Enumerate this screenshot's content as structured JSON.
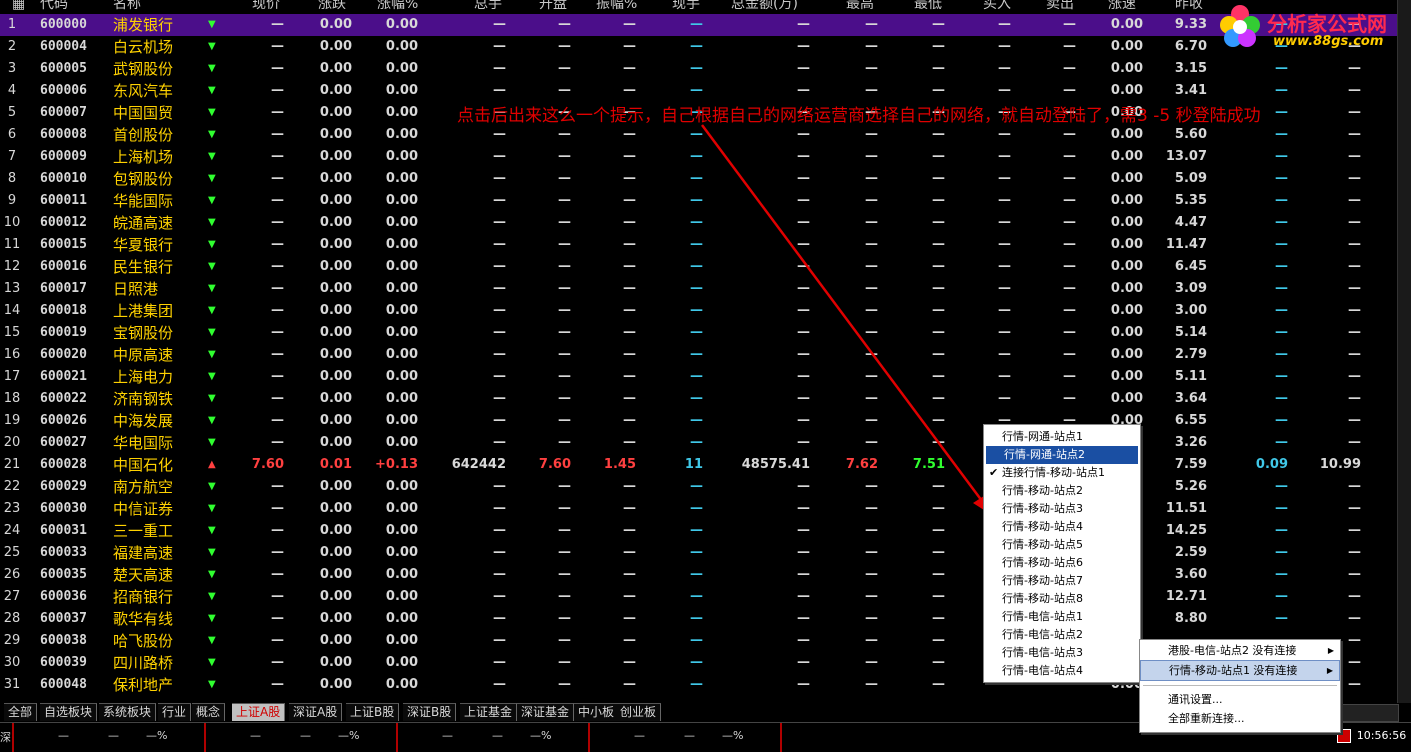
{
  "header": {
    "code": "代码",
    "name": "名称",
    "price": "现价",
    "change": "涨跌",
    "pct": "涨幅%",
    "volume": "总手",
    "open": "开盘",
    "amplitude": "振幅%",
    "cur_vol": "现手",
    "amount": "总金额(万)",
    "high": "最高",
    "low": "最低",
    "buy": "买入",
    "sell": "卖出",
    "speed": "涨速",
    "prev_close": "昨收"
  },
  "rows": [
    {
      "idx": "1",
      "code": "600000",
      "name": "浦发银行",
      "prev": "9.33"
    },
    {
      "idx": "2",
      "code": "600004",
      "name": "白云机场",
      "prev": "6.70"
    },
    {
      "idx": "3",
      "code": "600005",
      "name": "武钢股份",
      "prev": "3.15"
    },
    {
      "idx": "4",
      "code": "600006",
      "name": "东风汽车",
      "prev": "3.41"
    },
    {
      "idx": "5",
      "code": "600007",
      "name": "中国国贸",
      "prev": ""
    },
    {
      "idx": "6",
      "code": "600008",
      "name": "首创股份",
      "prev": "5.60"
    },
    {
      "idx": "7",
      "code": "600009",
      "name": "上海机场",
      "prev": "13.07"
    },
    {
      "idx": "8",
      "code": "600010",
      "name": "包钢股份",
      "prev": "5.09"
    },
    {
      "idx": "9",
      "code": "600011",
      "name": "华能国际",
      "prev": "5.35"
    },
    {
      "idx": "10",
      "code": "600012",
      "name": "皖通高速",
      "prev": "4.47"
    },
    {
      "idx": "11",
      "code": "600015",
      "name": "华夏银行",
      "prev": "11.47"
    },
    {
      "idx": "12",
      "code": "600016",
      "name": "民生银行",
      "prev": "6.45"
    },
    {
      "idx": "13",
      "code": "600017",
      "name": "日照港",
      "prev": "3.09"
    },
    {
      "idx": "14",
      "code": "600018",
      "name": "上港集团",
      "prev": "3.00"
    },
    {
      "idx": "15",
      "code": "600019",
      "name": "宝钢股份",
      "prev": "5.14"
    },
    {
      "idx": "16",
      "code": "600020",
      "name": "中原高速",
      "prev": "2.79"
    },
    {
      "idx": "17",
      "code": "600021",
      "name": "上海电力",
      "prev": "5.11"
    },
    {
      "idx": "18",
      "code": "600022",
      "name": "济南钢铁",
      "prev": "3.64"
    },
    {
      "idx": "19",
      "code": "600026",
      "name": "中海发展",
      "prev": "6.55"
    },
    {
      "idx": "20",
      "code": "600027",
      "name": "华电国际",
      "prev": "3.26"
    },
    {
      "idx": "21",
      "code": "600028",
      "name": "中国石化",
      "price": "7.60",
      "change": "0.01",
      "pct": "+0.13",
      "volume": "642442",
      "open": "7.60",
      "amplitude": "1.45",
      "cur_vol": "11",
      "amount": "48575.41",
      "high": "7.62",
      "low": "7.51",
      "prev": "7.59",
      "extra1": "0.09",
      "extra2": "10.99"
    },
    {
      "idx": "22",
      "code": "600029",
      "name": "南方航空",
      "prev": "5.26"
    },
    {
      "idx": "23",
      "code": "600030",
      "name": "中信证券",
      "prev": "11.51"
    },
    {
      "idx": "24",
      "code": "600031",
      "name": "三一重工",
      "prev": "14.25"
    },
    {
      "idx": "25",
      "code": "600033",
      "name": "福建高速",
      "prev": "2.59"
    },
    {
      "idx": "26",
      "code": "600035",
      "name": "楚天高速",
      "prev": "3.60"
    },
    {
      "idx": "27",
      "code": "600036",
      "name": "招商银行",
      "prev": "12.71"
    },
    {
      "idx": "28",
      "code": "600037",
      "name": "歌华有线",
      "prev": "8.80"
    },
    {
      "idx": "29",
      "code": "600038",
      "name": "哈飞股份",
      "prev": ""
    },
    {
      "idx": "30",
      "code": "600039",
      "name": "四川路桥",
      "prev": ""
    },
    {
      "idx": "31",
      "code": "600048",
      "name": "保利地产",
      "prev": ""
    }
  ],
  "dash": "—",
  "zero": "0.00",
  "tabs": [
    "全部",
    "自选板块",
    "系统板块",
    "行业",
    "概念",
    "上证A股",
    "深证A股",
    "上证B股",
    "深证B股",
    "上证基金",
    "深证基金",
    "中小板",
    "创业板"
  ],
  "active_tab": "上证A股",
  "status": {
    "s1": "—",
    "s2": "—",
    "s3": "—%",
    "clock": "10:56:56",
    "left": "深"
  },
  "menu_main": [
    {
      "label": "行情-网通-站点1"
    },
    {
      "label": "行情-网通-站点2",
      "highlight": true
    },
    {
      "label": "连接行情-移动-站点1",
      "checked": true
    },
    {
      "label": "行情-移动-站点2"
    },
    {
      "label": "行情-移动-站点3"
    },
    {
      "label": "行情-移动-站点4"
    },
    {
      "label": "行情-移动-站点5"
    },
    {
      "label": "行情-移动-站点6"
    },
    {
      "label": "行情-移动-站点7"
    },
    {
      "label": "行情-移动-站点8"
    },
    {
      "label": "行情-电信-站点1"
    },
    {
      "label": "行情-电信-站点2"
    },
    {
      "label": "行情-电信-站点3"
    },
    {
      "label": "行情-电信-站点4"
    }
  ],
  "menu_sub": [
    {
      "label": "港股-电信-站点2 没有连接",
      "arrow": true
    },
    {
      "label": "行情-移动-站点1 没有连接",
      "arrow": true,
      "highlight": true
    },
    {
      "label": "通讯设置..."
    },
    {
      "label": "全部重新连接..."
    }
  ],
  "annotation": "点击后出来这么一个提示，自己根据自己的网络运营商选择自己的网络，就自动登陆了，需3 -5 秒登陆成功",
  "logo": {
    "name": "分析家公式网",
    "url": "www.88gs.com"
  },
  "colors": {
    "selected_row": "#4b0e8a",
    "menu_highlight": "#1a4fa3",
    "annotation": "#e00000",
    "name_yellow": "#ffd200"
  }
}
